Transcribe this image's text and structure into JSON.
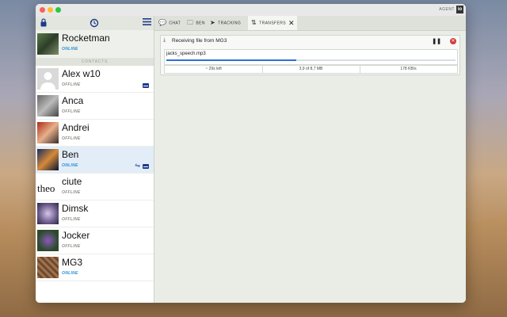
{
  "window": {
    "agent_label": "AGENT",
    "agent_logo": "io"
  },
  "traffic_lights": {
    "close_color": "#ff5f57",
    "minimize_color": "#febc2e",
    "zoom_color": "#28c840"
  },
  "sidebar": {
    "top_icons": {
      "lock": "lock-icon",
      "history": "history-icon",
      "menu": "menu-icon"
    },
    "me": {
      "name": "Rocketman",
      "status": "ONLINE"
    },
    "contacts_header": "CONTACTS",
    "contacts": [
      {
        "name": "Alex w10",
        "status": "OFFLINE",
        "has_message": true
      },
      {
        "name": "Anca",
        "status": "OFFLINE"
      },
      {
        "name": "Andrei",
        "status": "OFFLINE"
      },
      {
        "name": "Ben",
        "status": "ONLINE",
        "has_message": true,
        "transfer": true,
        "selected": true
      },
      {
        "name": "ciute",
        "status": "OFFLINE",
        "avatar_text": "theo"
      },
      {
        "name": "Dimsk",
        "status": "OFFLINE"
      },
      {
        "name": "Jocker",
        "status": "OFFLINE"
      },
      {
        "name": "MG3",
        "status": "ONLINE"
      }
    ]
  },
  "tabs": [
    {
      "label": "CHAT",
      "icon": "chat-icon"
    },
    {
      "label": "BEN",
      "icon": "folder-icon"
    },
    {
      "label": "TRACKING",
      "icon": "navigation-icon"
    },
    {
      "label": "TRANSFERS",
      "icon": "transfer-icon",
      "active": true
    }
  ],
  "transfer": {
    "title": "Receiving file from MG3",
    "file_name": "jacks_speech.mp3",
    "progress": 0.45,
    "time_left": "~ 29s left",
    "size_progress": "3,9 of 8,7 MB",
    "speed": "178 KB/s"
  },
  "colors": {
    "online": "#2a8fd6",
    "offline": "#8a8f86",
    "accent": "#2f6fd6"
  }
}
